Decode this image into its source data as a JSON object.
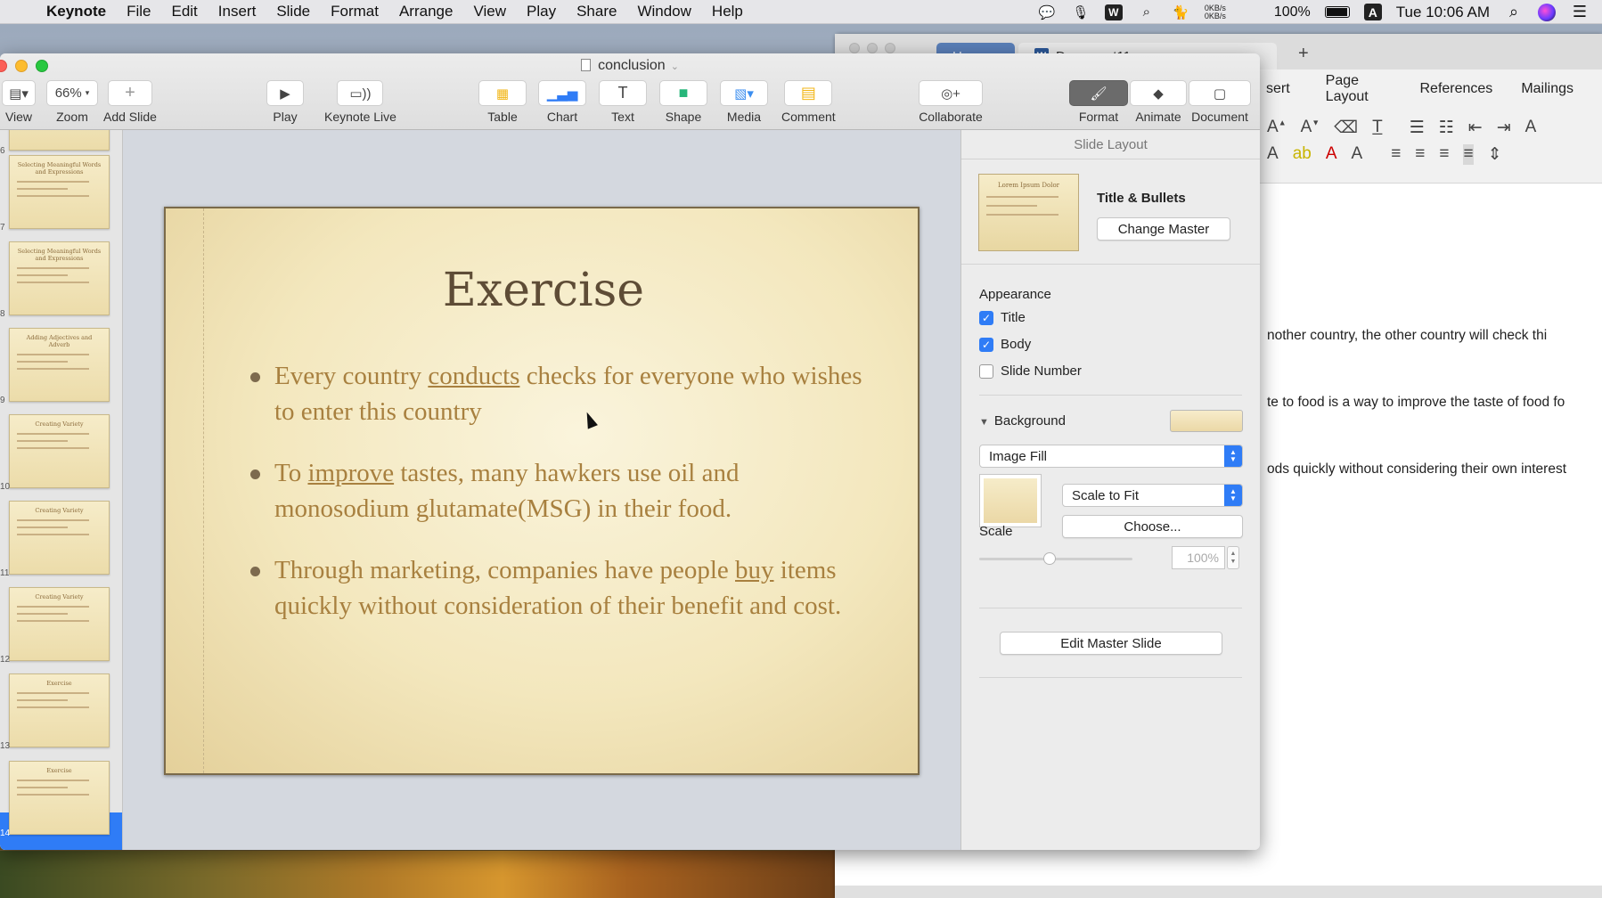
{
  "menubar": {
    "app": "Keynote",
    "items": [
      "File",
      "Edit",
      "Insert",
      "Slide",
      "Format",
      "Arrange",
      "View",
      "Play",
      "Share",
      "Window",
      "Help"
    ],
    "net_up": "0KB/s",
    "net_down": "0KB/s",
    "battery": "100%",
    "input_source": "A",
    "clock": "Tue 10:06 AM"
  },
  "word": {
    "tab_home": "Home",
    "tab_doc": "Document11",
    "ribbon_tabs": [
      "sert",
      "Page Layout",
      "References",
      "Mailings"
    ],
    "lines": [
      "nother country, the other country will check thi",
      "te to food is a way to improve the taste of food fo",
      "ods quickly without considering their own interest"
    ]
  },
  "keynote": {
    "doc_title": "conclusion",
    "toolbar": {
      "view": "View",
      "zoom_value": "66%",
      "zoom": "Zoom",
      "add_slide": "Add Slide",
      "play": "Play",
      "keynote_live": "Keynote Live",
      "table": "Table",
      "chart": "Chart",
      "text": "Text",
      "shape": "Shape",
      "media": "Media",
      "comment": "Comment",
      "collaborate": "Collaborate",
      "format": "Format",
      "animate": "Animate",
      "document": "Document"
    },
    "navigator": {
      "thumbs": [
        {
          "num": "6",
          "title": ""
        },
        {
          "num": "7",
          "title": "Selecting Meaningful Words and Expressions"
        },
        {
          "num": "8",
          "title": "Selecting Meaningful Words and Expressions"
        },
        {
          "num": "9",
          "title": "Adding Adjectives and Adverb"
        },
        {
          "num": "10",
          "title": "Creating Variety"
        },
        {
          "num": "11",
          "title": "Creating Variety"
        },
        {
          "num": "12",
          "title": "Creating Variety"
        },
        {
          "num": "13",
          "title": "Exercise"
        },
        {
          "num": "14",
          "title": "Exercise"
        }
      ]
    },
    "slide": {
      "title": "Exercise",
      "bullet1_pre": "Every country ",
      "bullet1_u": "conducts",
      "bullet1_post": " checks for everyone who wishes to enter this country",
      "bullet2_pre": "To ",
      "bullet2_u": "improve",
      "bullet2_post": " tastes, many hawkers use oil and monosodium glutamate(MSG) in their food.",
      "bullet3_pre": "Through marketing, companies have people ",
      "bullet3_u": "buy",
      "bullet3_post": " items quickly without consideration of their benefit and cost."
    },
    "inspector": {
      "header": "Slide Layout",
      "master_thumb_title": "Lorem Ipsum Dolor",
      "master_name": "Title & Bullets",
      "change_master": "Change Master",
      "appearance": "Appearance",
      "title_label": "Title",
      "body_label": "Body",
      "slide_number_label": "Slide Number",
      "background": "Background",
      "fill_type": "Image Fill",
      "scale_mode": "Scale to Fit",
      "choose": "Choose...",
      "scale": "Scale",
      "scale_value": "100%",
      "edit_master": "Edit Master Slide"
    }
  }
}
